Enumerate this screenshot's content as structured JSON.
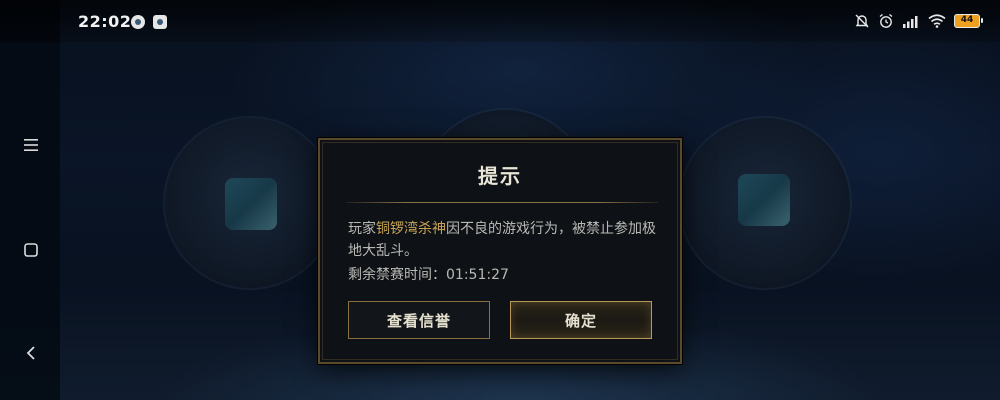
{
  "status_bar": {
    "time": "22:02",
    "battery_level": "44",
    "icons": [
      "app-notification-icon",
      "app-notification-icon",
      "mute-bell-icon",
      "alarm-icon",
      "signal-icon",
      "wifi-icon",
      "battery-icon"
    ]
  },
  "nav": {
    "icons": [
      "menu-icon",
      "home-square-icon",
      "back-chevron-icon"
    ]
  },
  "modes": {
    "left_label": "",
    "right_label": ""
  },
  "dialog": {
    "title": "提示",
    "message_prefix": "玩家",
    "player_name": "铜锣湾杀神",
    "message_suffix": "因不良的游戏行为，被禁止参加极地大乱斗。",
    "remaining_label": "剩余禁赛时间：",
    "remaining_time": "01:51:27",
    "secondary_button": "查看信誉",
    "primary_button": "确定"
  },
  "colors": {
    "dialog_border": "#5b4a2a",
    "highlight": "#c8a456",
    "battery": "#f0a020"
  }
}
